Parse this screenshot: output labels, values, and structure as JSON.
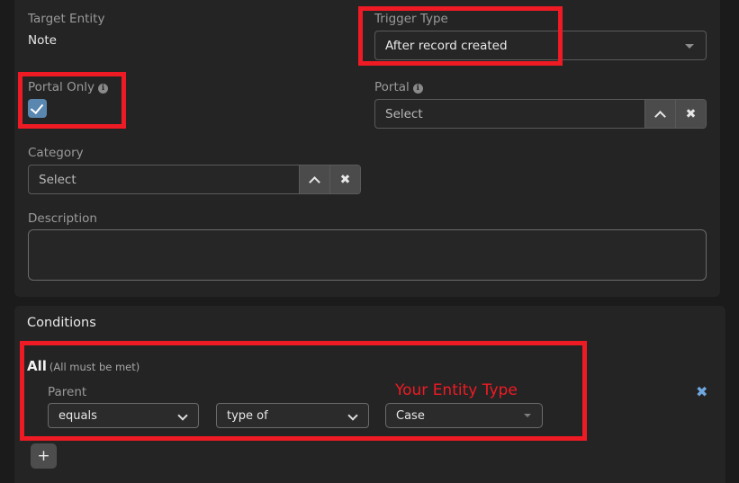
{
  "main_panel": {
    "target_entity": {
      "label": "Target Entity",
      "value": "Note"
    },
    "portal_only": {
      "label": "Portal Only",
      "info_icon": "info-icon",
      "checked": true
    },
    "category": {
      "label": "Category",
      "placeholder": "Select",
      "value": ""
    },
    "description": {
      "label": "Description",
      "value": ""
    },
    "trigger_type": {
      "label": "Trigger Type",
      "value": "After record created"
    },
    "portal": {
      "label": "Portal",
      "info_icon": "info-icon",
      "placeholder": "Select",
      "value": ""
    }
  },
  "conditions_panel": {
    "title": "Conditions",
    "group": {
      "operator": "All",
      "operator_note": "(All must be met)",
      "row": {
        "field_label": "Parent",
        "comparator": "equals",
        "relation": "type of",
        "entity": "Case",
        "remove_label": "✖"
      }
    },
    "add_button_label": "+"
  },
  "annotations": {
    "entity_type_note": "Your Entity Type",
    "highlight_color": "#ee1b24"
  },
  "icons": {
    "chevron_up": "chevron-up-icon",
    "chevron_down": "chevron-down-icon",
    "clear": "clear-x-icon",
    "info": "info-icon",
    "plus": "plus-icon",
    "caret_down": "caret-down-icon"
  },
  "colors": {
    "accent_blue": "#5a87b0",
    "link_blue": "#6fa8e0",
    "annotation_red": "#ee1b24",
    "panel_bg": "#242424",
    "page_bg": "#1b1b1b"
  }
}
